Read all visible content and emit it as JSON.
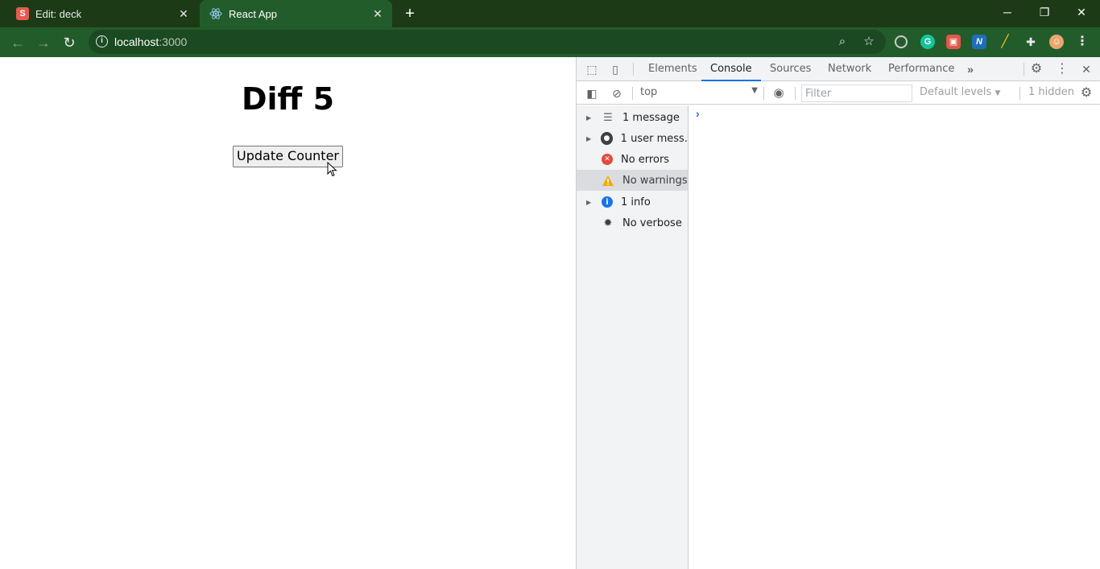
{
  "browser": {
    "tabs": [
      {
        "title": "Edit: deck",
        "favicon": "s-icon",
        "active": false
      },
      {
        "title": "React App",
        "favicon": "react-icon",
        "active": true
      }
    ],
    "url_host": "localhost",
    "url_port": ":3000"
  },
  "page": {
    "heading": "Diff 5",
    "button_label": "Update Counter"
  },
  "devtools": {
    "tabs": [
      "Elements",
      "Console",
      "Sources",
      "Network",
      "Performance"
    ],
    "active_tab": "Console",
    "context": "top",
    "filter_placeholder": "Filter",
    "levels_label": "Default levels",
    "hidden_count": "1 hidden",
    "sidebar": [
      {
        "label": "1 message",
        "icon": "list-icon",
        "expandable": true,
        "selected": false
      },
      {
        "label": "1 user mess...",
        "icon": "user-icon",
        "expandable": true,
        "selected": false
      },
      {
        "label": "No errors",
        "icon": "error-icon",
        "expandable": false,
        "selected": false
      },
      {
        "label": "No warnings",
        "icon": "warning-icon",
        "expandable": false,
        "selected": true
      },
      {
        "label": "1 info",
        "icon": "info-icon",
        "expandable": true,
        "selected": false
      },
      {
        "label": "No verbose",
        "icon": "bug-icon",
        "expandable": false,
        "selected": false
      }
    ],
    "colors": {
      "accent": "#1a73e8",
      "error": "#d93025",
      "warning": "#f2ab00",
      "info": "#1a73e8"
    }
  }
}
